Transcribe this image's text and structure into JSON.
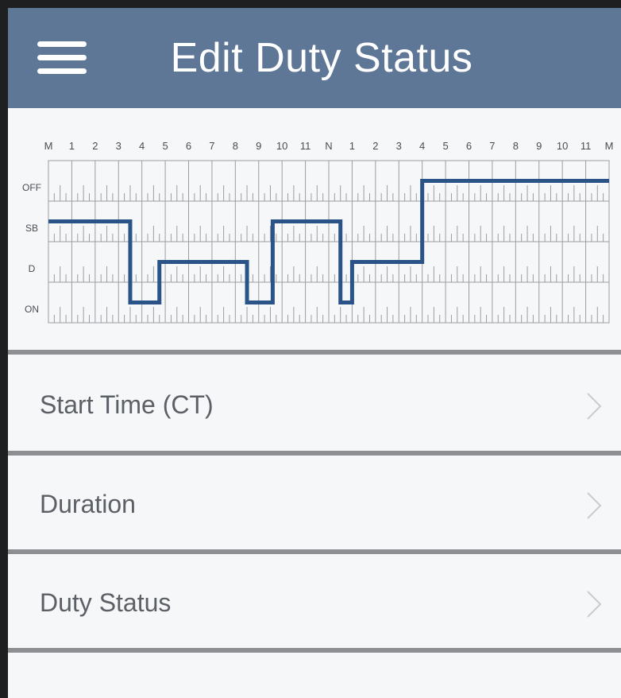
{
  "header": {
    "title": "Edit Duty Status",
    "menu_icon": "hamburger-menu-icon"
  },
  "log_graph": {
    "hour_labels": [
      "M",
      "1",
      "2",
      "3",
      "4",
      "5",
      "6",
      "7",
      "8",
      "9",
      "10",
      "11",
      "N",
      "1",
      "2",
      "3",
      "4",
      "5",
      "6",
      "7",
      "8",
      "9",
      "10",
      "11",
      "M"
    ],
    "status_labels": [
      "OFF",
      "SB",
      "D",
      "ON"
    ],
    "line_color": "#2a5388",
    "segments": [
      {
        "status": "SB",
        "start_hour": 0,
        "end_hour": 3.5
      },
      {
        "status": "ON",
        "start_hour": 3.5,
        "end_hour": 4.75
      },
      {
        "status": "D",
        "start_hour": 4.75,
        "end_hour": 8.5
      },
      {
        "status": "ON",
        "start_hour": 8.5,
        "end_hour": 9.6
      },
      {
        "status": "SB",
        "start_hour": 9.6,
        "end_hour": 12.5
      },
      {
        "status": "ON",
        "start_hour": 12.5,
        "end_hour": 13.0
      },
      {
        "status": "D",
        "start_hour": 13.0,
        "end_hour": 16.0
      },
      {
        "status": "OFF",
        "start_hour": 16.0,
        "end_hour": 24.0
      }
    ]
  },
  "rows": [
    {
      "label": "Start Time (CT)",
      "icon": "chevron-right-icon"
    },
    {
      "label": "Duration",
      "icon": "chevron-right-icon"
    },
    {
      "label": "Duty Status",
      "icon": "chevron-right-icon"
    }
  ]
}
